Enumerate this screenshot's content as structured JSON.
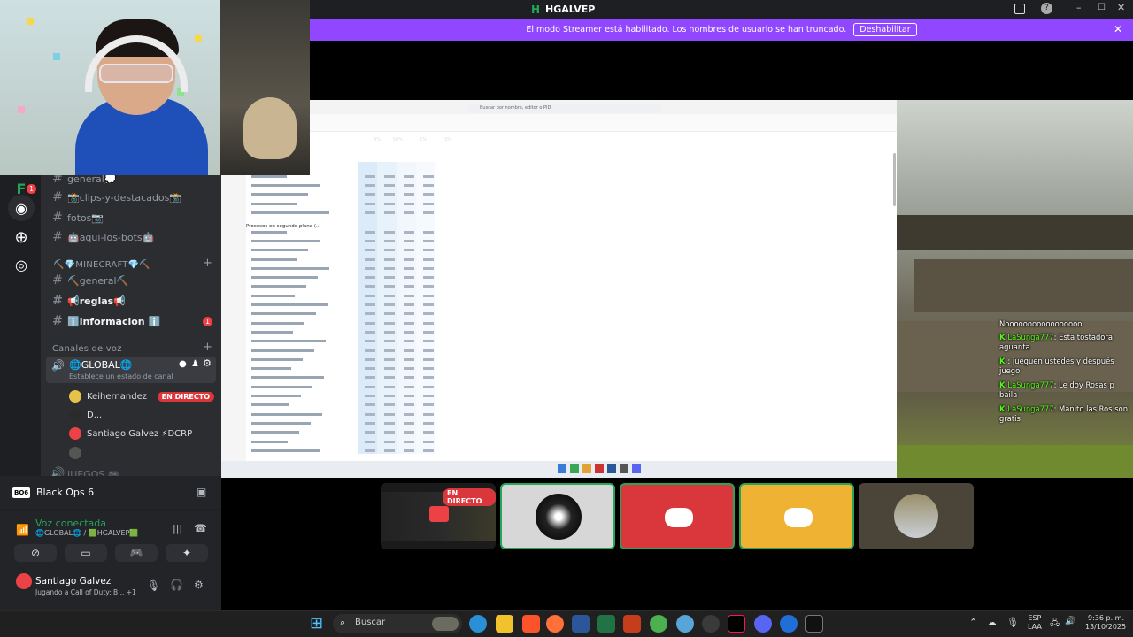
{
  "window": {
    "title": "HGALVEP"
  },
  "banner": {
    "text": "El modo Streamer está habilitado. Los nombres de usuario se han truncado.",
    "button": "Deshabilitar"
  },
  "guilds": {
    "badge": "1"
  },
  "channels": {
    "items": [
      {
        "label": "general💭"
      },
      {
        "label": "📸clips-y-destacados📸"
      },
      {
        "label": "fotos📷"
      },
      {
        "label": "🤖aqui-los-bots🤖"
      }
    ],
    "minecraft_category": "⛏️💎MINECRAFT💎⛏️",
    "minecraft_items": [
      {
        "label": "⛏️general⛏️",
        "bright": false
      },
      {
        "label": "📢reglas📢",
        "bright": true
      },
      {
        "label": "ℹ️informacion ℹ️",
        "bright": true,
        "badge": "1"
      }
    ],
    "voice_category": "Canales de voz",
    "voice_channel": "🌐GLOBAL🌐",
    "voice_status": "Establece un estado de canal",
    "voice_users": [
      {
        "name": "Keihernandez",
        "live": "EN DIRECTO",
        "color": "#e5c34a"
      },
      {
        "name": "D...",
        "live": "",
        "color": "#2b2b2b"
      },
      {
        "name": "Santiago Galvez ⚡DCRP",
        "live": "",
        "color": "#ed4245"
      },
      {
        "name": "",
        "live": "",
        "color": "#555"
      }
    ],
    "next_channel": "JUEGOS 🎮"
  },
  "panel": {
    "game": "Black Ops 6",
    "voice_connected": "Voz conectada",
    "voice_path": "🌐GLOBAL🌐 / 🟩HGALVEP🟩",
    "user_name": "Santiago Galvez",
    "user_status": "Jugando a Call of Duty: B... +1"
  },
  "taskmgr": {
    "search_placeholder": "Buscar por nombre, editor o PID",
    "headers": {
      "cpu": "4%",
      "mem": "58%",
      "disk": "1%",
      "net": "3%"
    },
    "bg_section": "Procesos en segundo plano (..."
  },
  "chat": [
    {
      "user": "LaSunga777",
      "msg": ": Esta tostadora aguanta"
    },
    {
      "user": "",
      "msg": ": jueguen ustedes y después juego"
    },
    {
      "user": "LaSunga777",
      "msg": ": Le doy Rosas p baila"
    },
    {
      "user": "LaSunga777",
      "msg": ": Manito las Ros son gratis"
    }
  ],
  "chat_top": "Nooooooooooooooooo",
  "tiles": {
    "live": "EN DIRECTO"
  },
  "taskbar": {
    "search": "Buscar",
    "lang": "ESP",
    "lang2": "LAA",
    "time": "9:36 p. m.",
    "date": "13/10/2025"
  },
  "colors": {
    "accent": "#9147ff",
    "discord_green": "#23a55a",
    "live_red": "#da373c",
    "discord_bg": "#2b2d31"
  }
}
